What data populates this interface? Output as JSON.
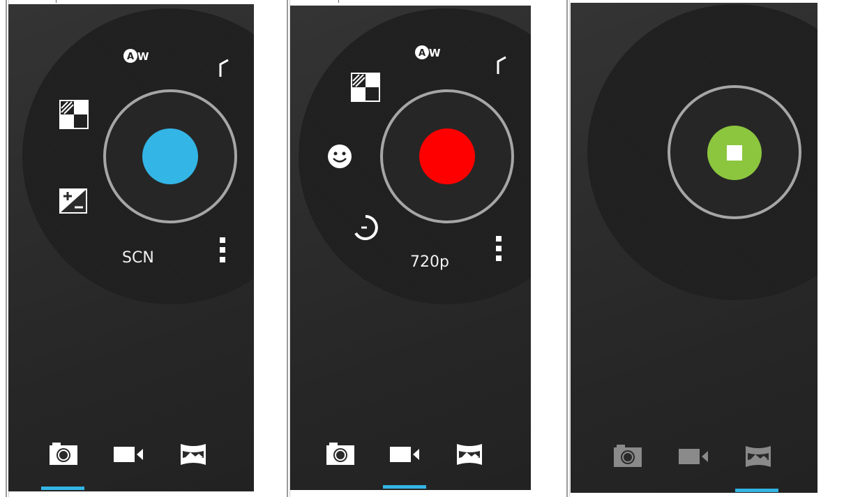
{
  "colors": {
    "accent": "#33b5e5",
    "photo_shutter": "#33b5e5",
    "video_record": "#ff0000",
    "panorama_stop": "#8cc63f",
    "ring": "#a6a6a6",
    "icon": "#ffffff",
    "icon_dim": "#8a8a8a"
  },
  "screens": [
    {
      "mode": "photo",
      "scene_label": "SCN",
      "settings_icons": [
        "auto-white-balance-icon",
        "flash-icon",
        "exposure-icon",
        "exposure-compensation-icon",
        "more-menu-icon"
      ],
      "shutter_icon": "shutter-button",
      "active_tab": "camera"
    },
    {
      "mode": "video",
      "scene_label": "720p",
      "settings_icons": [
        "auto-white-balance-icon",
        "flash-icon",
        "exposure-icon",
        "face-detection-icon",
        "timer-icon",
        "more-menu-icon"
      ],
      "shutter_icon": "record-button",
      "active_tab": "video"
    },
    {
      "mode": "panorama",
      "scene_label": "",
      "settings_icons": [],
      "shutter_icon": "stop-button",
      "active_tab": "panorama"
    }
  ],
  "tabs": [
    "camera-icon",
    "video-icon",
    "panorama-icon"
  ]
}
